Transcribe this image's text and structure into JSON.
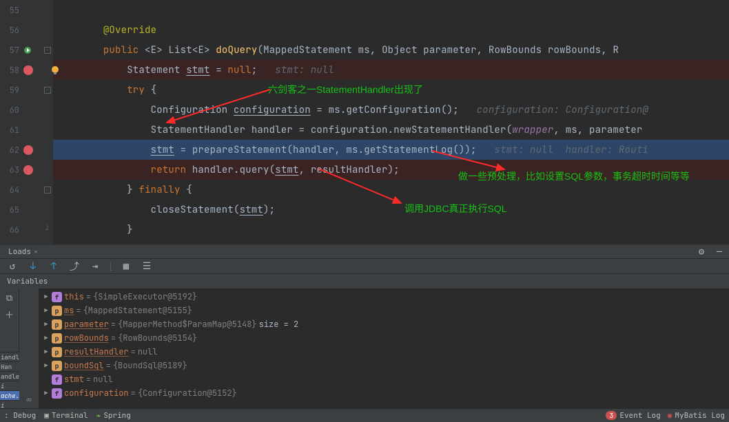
{
  "gutter": {
    "lines": [
      "55",
      "56",
      "57",
      "58",
      "59",
      "60",
      "61",
      "62",
      "63",
      "64",
      "65",
      "66",
      ""
    ],
    "breakpoints": {
      "58": "bp",
      "62": "bp",
      "63": "bp"
    },
    "run_marker_line": "57",
    "bulb_line": "58",
    "fold_markers": {
      "57": "start",
      "59": "start",
      "64": "mid",
      "66": "end"
    }
  },
  "code": {
    "l55": "",
    "l56": {
      "indent": "        ",
      "anno": "@Override"
    },
    "l57": {
      "indent": "        ",
      "kw1": "public ",
      "gen": "<",
      "t1": "E",
      "gen2": "> ",
      "t2": "List",
      "gen3": "<",
      "t3": "E",
      "gen4": "> ",
      "m": "doQuery",
      "p": "(MappedStatement ms, Object parameter, RowBounds rowBounds, R"
    },
    "l58": {
      "indent": "            ",
      "t": "Statement ",
      "v": "stmt",
      "rest": " = ",
      "kw": "null",
      "semi": ";   ",
      "hint": "stmt: null"
    },
    "l59": {
      "indent": "            ",
      "kw": "try",
      "rest": " {"
    },
    "l60": {
      "indent": "                ",
      "t": "Configuration ",
      "v": "configuration",
      "rest": " = ms.getConfiguration();   ",
      "hint": "configuration: Configuration@"
    },
    "l61": {
      "indent": "                ",
      "t": "StatementHandler ",
      "v": "handler",
      "rest1": " = configuration.newStatementHandler(",
      "p1": "wrapper",
      "rest2": ", ms, parameter"
    },
    "l62": {
      "indent": "                ",
      "v": "stmt",
      "rest": " = prepareStatement(handler, ms.getStatementLog());   ",
      "hint": "stmt: null  handler: Routi"
    },
    "l63": {
      "indent": "                ",
      "kw": "return",
      "rest1": " handler.query(",
      "v": "stmt",
      "rest2": ", resultHandler);"
    },
    "l64": {
      "indent": "            ",
      "rest1": "} ",
      "kw": "finally",
      "rest2": " {"
    },
    "l65": {
      "indent": "                ",
      "m": "closeStatement(",
      "v": "stmt",
      "rest": ");"
    },
    "l66": {
      "indent": "            ",
      "rest": "}"
    },
    "l67": {
      "indent": "        ",
      "rest": "}"
    }
  },
  "annotations": {
    "a1": "六剑客之一StatementHandler出现了",
    "a2": "做一些预处理，比如设置SQL参数，事务超时时间等等",
    "a3": "调用JDBC真正执行SQL"
  },
  "tabbar": {
    "tab1": "Loads"
  },
  "btnbar_icons": [
    "↺",
    "↓",
    "↑",
    "⤴",
    "⇥",
    "⏭",
    "▦",
    "☰"
  ],
  "var_header": "Variables",
  "side_tools": [
    "⧉",
    "＋"
  ],
  "side_infinity": "∞",
  "thread_tabs": [
    "iandl",
    "Han",
    "andle",
    "i (or",
    "ache.",
    "i (on"
  ],
  "vars": [
    {
      "badge": "f",
      "name": "this",
      "eq": " = ",
      "val": "{SimpleExecutor@5192}",
      "ul": false
    },
    {
      "badge": "p",
      "name": "ms",
      "eq": " = ",
      "val": "{MappedStatement@5155}",
      "ul": true
    },
    {
      "badge": "p",
      "name": "parameter",
      "eq": " = ",
      "val": "{MapperMethod$ParamMap@5148}",
      "extra": "  size = 2",
      "ul": true
    },
    {
      "badge": "p",
      "name": "rowBounds",
      "eq": " = ",
      "val": "{RowBounds@5154}",
      "ul": true
    },
    {
      "badge": "p",
      "name": "resultHandler",
      "eq": " = ",
      "val": "null",
      "ul": true
    },
    {
      "badge": "p",
      "name": "boundSql",
      "eq": " = ",
      "val": "{BoundSql@5189}",
      "ul": true
    },
    {
      "badge": "f",
      "name": "stmt",
      "eq": " = ",
      "val": "null",
      "ul": false,
      "notw": true
    },
    {
      "badge": "f",
      "name": "configuration",
      "eq": " = ",
      "val": "{Configuration@5152}",
      "ul": false
    }
  ],
  "status": {
    "debug": ": Debug",
    "terminal": "Terminal",
    "spring": "Spring",
    "count": "3",
    "event": "Event Log",
    "mybatis": "MyBatis Log"
  }
}
